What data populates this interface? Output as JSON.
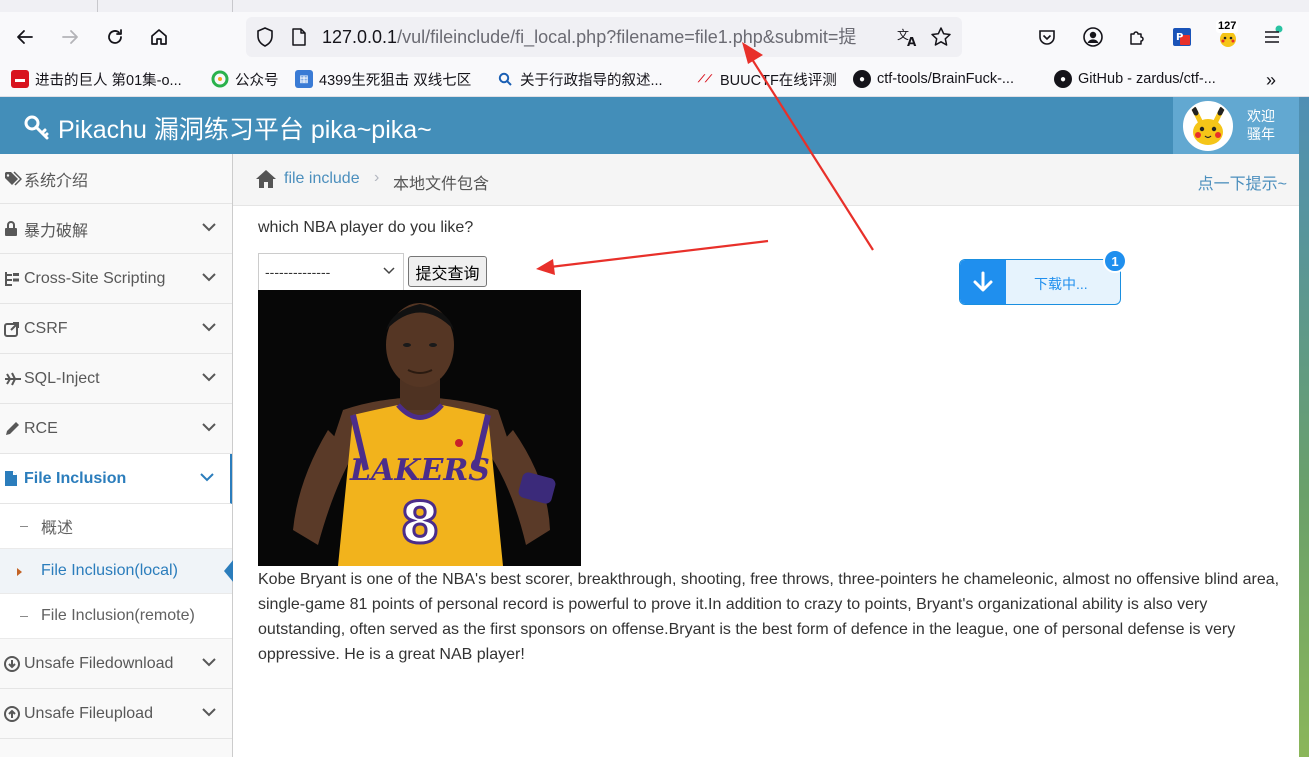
{
  "browser": {
    "url_host": "127.0.0.1",
    "url_path": "/vul/fileinclude/fi_local.php?filename=file1.php&submit=提",
    "extension_badge": "127",
    "bookmarks": [
      {
        "label": "进击的巨人 第01集-o...",
        "icon": "video-site-icon"
      },
      {
        "label": "公众号",
        "icon": "wechat-icon"
      },
      {
        "label": "4399生死狙击 双线七区",
        "icon": "game-site-icon"
      },
      {
        "label": "关于行政指导的叙述...",
        "icon": "search-icon"
      },
      {
        "label": "BUUCTF在线评测",
        "icon": "buuctf-icon"
      },
      {
        "label": "ctf-tools/BrainFuck-...",
        "icon": "github-icon"
      },
      {
        "label": "GitHub - zardus/ctf-...",
        "icon": "github-icon"
      }
    ]
  },
  "site": {
    "title": "Pikachu 漏洞练习平台 pika~pika~",
    "welcome_line1": "欢迎",
    "welcome_line2": "骚年"
  },
  "sidebar": {
    "items": [
      {
        "label": "系统介绍",
        "icon": "tags-icon",
        "expandable": false
      },
      {
        "label": "暴力破解",
        "icon": "lock-icon",
        "expandable": true
      },
      {
        "label": "Cross-Site Scripting",
        "icon": "sitemap-icon",
        "expandable": true
      },
      {
        "label": "CSRF",
        "icon": "external-link-icon",
        "expandable": true
      },
      {
        "label": "SQL-Inject",
        "icon": "plane-icon",
        "expandable": true
      },
      {
        "label": "RCE",
        "icon": "pencil-icon",
        "expandable": true
      },
      {
        "label": "File Inclusion",
        "icon": "file-icon",
        "expandable": true,
        "active": true
      },
      {
        "label": "Unsafe Filedownload",
        "icon": "download-circle-icon",
        "expandable": true
      },
      {
        "label": "Unsafe Fileupload",
        "icon": "upload-circle-icon",
        "expandable": true
      }
    ],
    "subitems": [
      {
        "label": "概述"
      },
      {
        "label": "File Inclusion(local)",
        "current": true
      },
      {
        "label": "File Inclusion(remote)"
      }
    ]
  },
  "breadcrumb": {
    "link": "file include",
    "current": "本地文件包含",
    "hint": "点一下提示~"
  },
  "main": {
    "question": "which NBA player do you like?",
    "select_value": "--------------",
    "submit_label": "提交查询",
    "bio": "Kobe Bryant is one of the NBA's best scorer, breakthrough, shooting, free throws, three-pointers he chameleonic, almost no offensive blind area, single-game 81 points of personal record is powerful to prove it.In addition to crazy to points, Bryant's organizational ability is also very outstanding, often served as the first sponsors on offense.Bryant is the best form of defence in the league, one of personal defense is very oppressive. He is a great NAB player!",
    "jersey_text": "LAKERS",
    "jersey_number": "8"
  },
  "download_widget": {
    "text": "下载中...",
    "badge": "1"
  },
  "colors": {
    "header": "#438eb9",
    "accent": "#2b7dbc",
    "annotation": "#e8302a"
  }
}
